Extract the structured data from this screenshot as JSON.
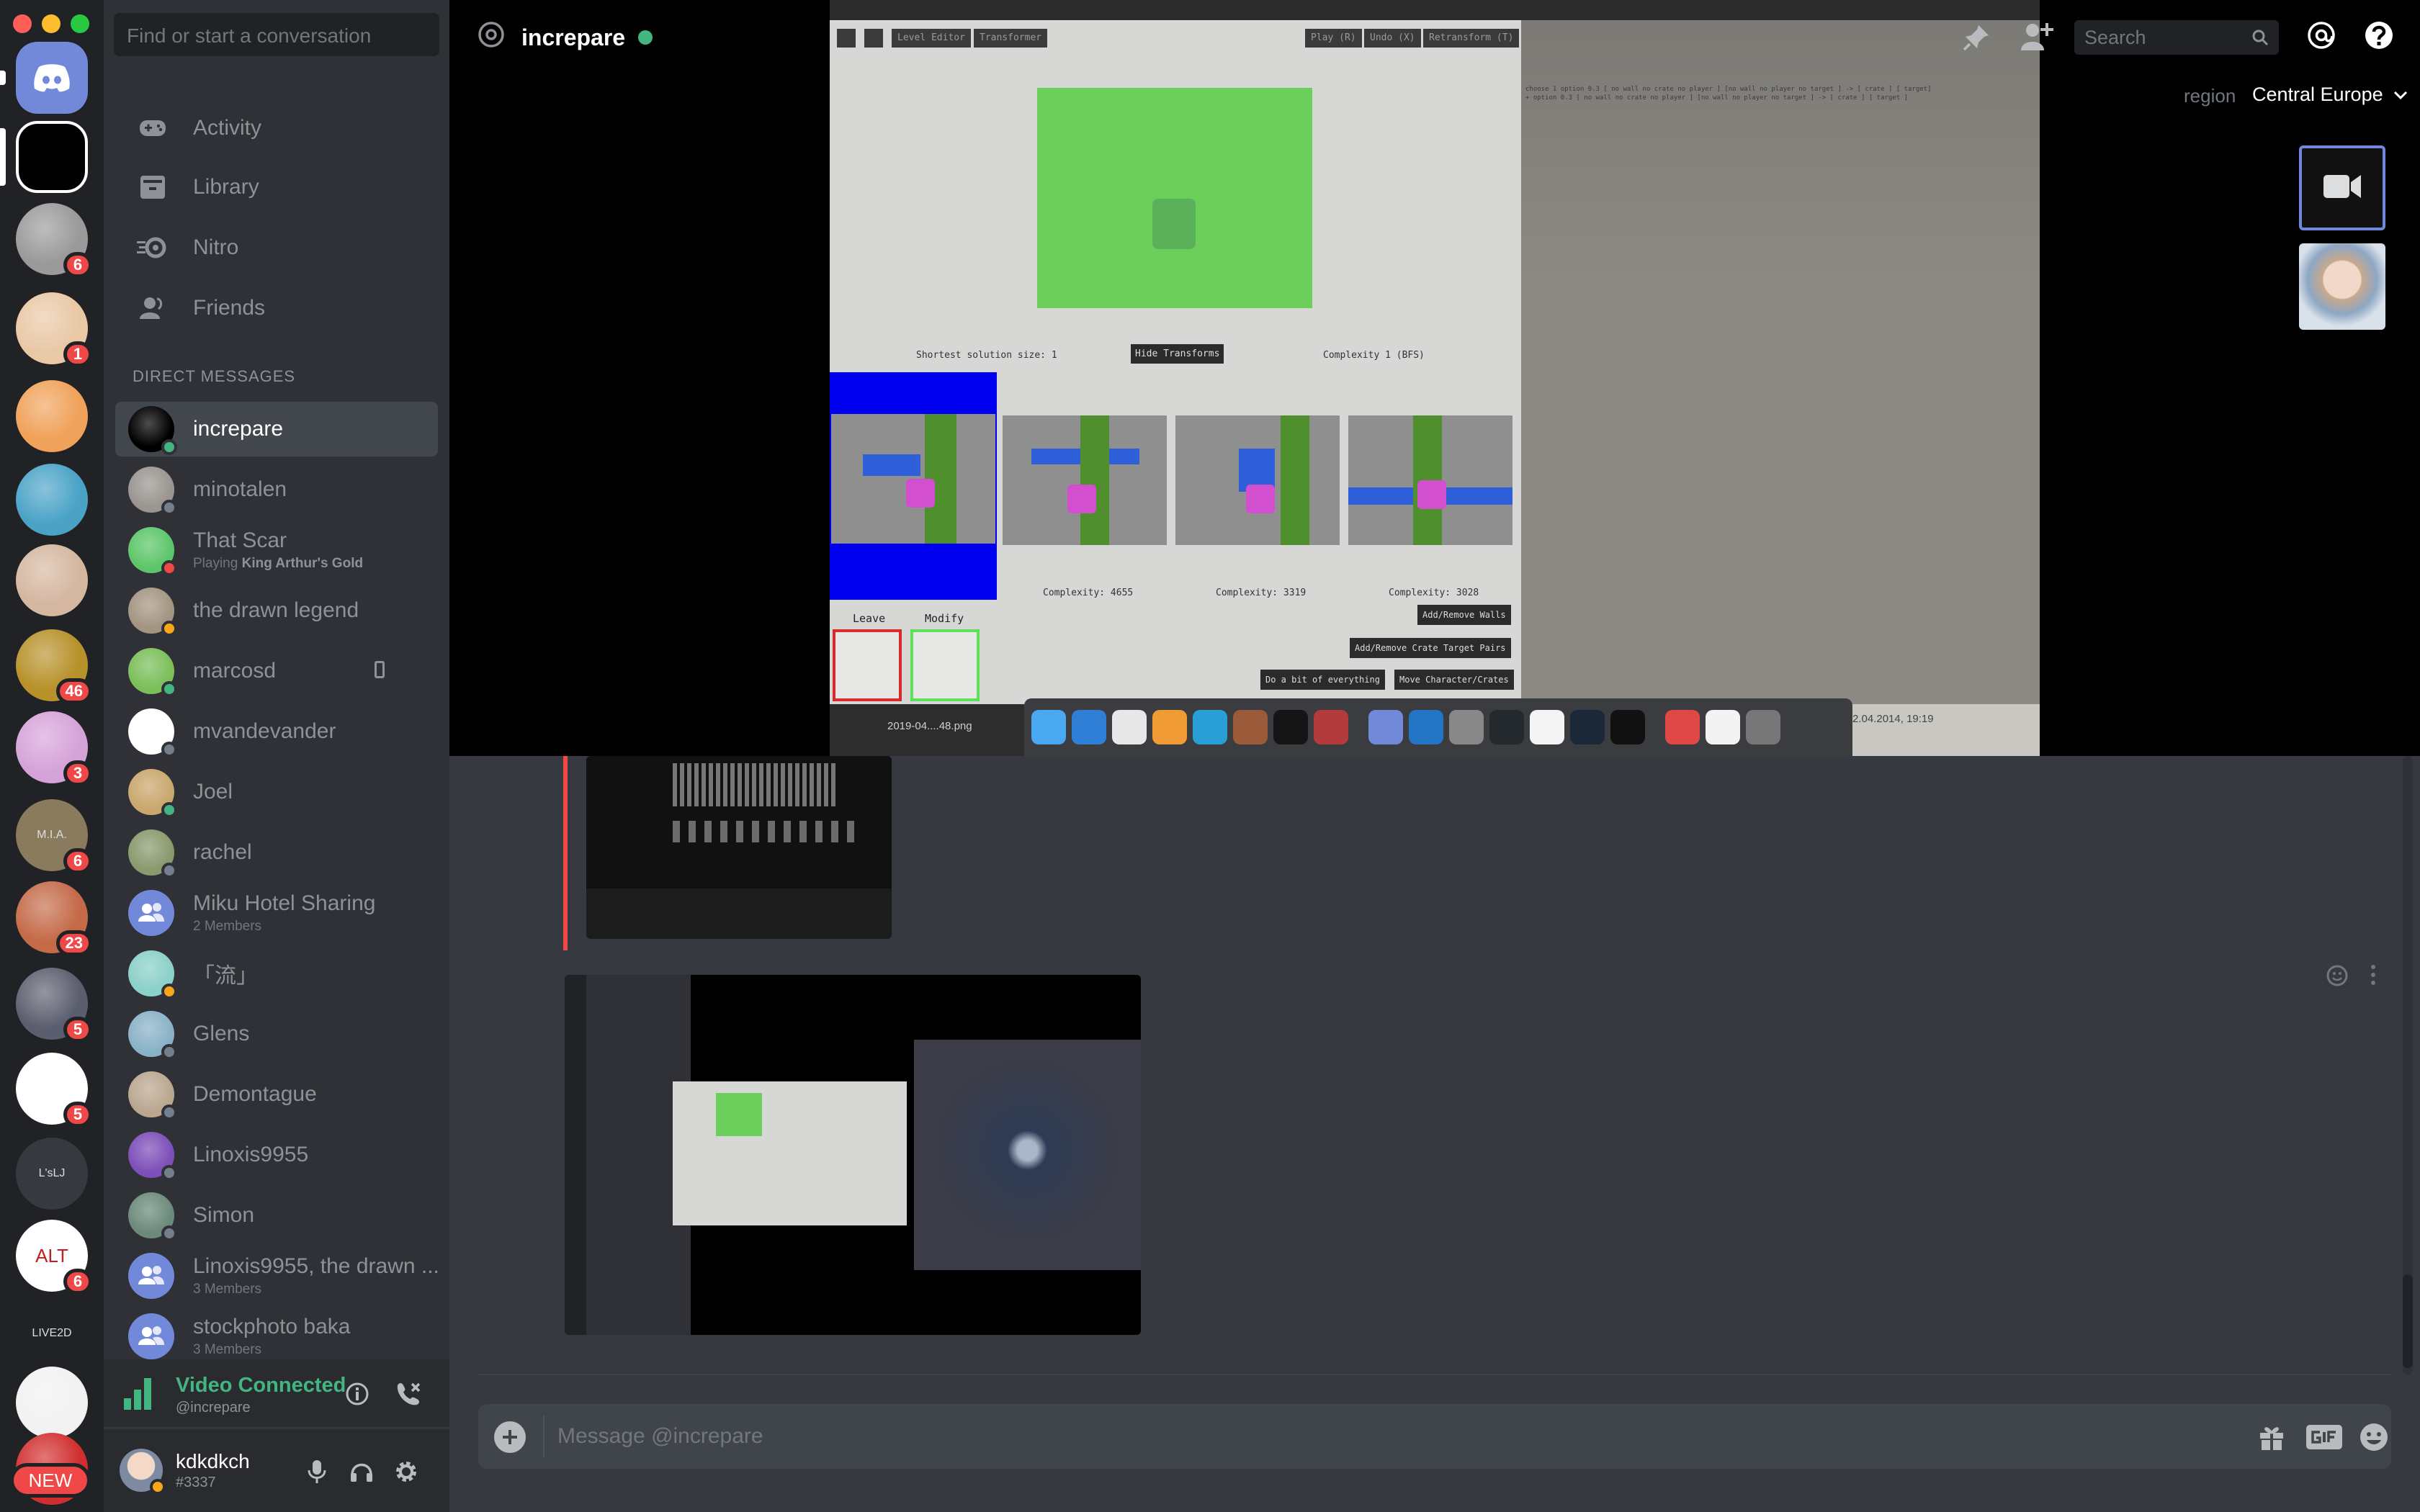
{
  "window": {
    "traffic_lights": {
      "close": "#ff5f57",
      "minimize": "#febc2e",
      "zoom": "#28c840"
    }
  },
  "servers": [
    {
      "name": "home",
      "icon": "discord-logo-icon",
      "badge": "",
      "color": "#7289da"
    },
    {
      "name": "video-call",
      "icon": "video-call-server-icon",
      "badge": "",
      "color": "#000000"
    },
    {
      "name": "server-3",
      "icon": "sketch-avatar-icon",
      "badge": "6",
      "color": "#9a9a9a"
    },
    {
      "name": "server-4",
      "icon": "anime-avatar-icon",
      "badge": "1",
      "color": "#e9c8a6"
    },
    {
      "name": "server-5",
      "icon": "skull-avatar-icon",
      "badge": "",
      "color": "#f0a25a"
    },
    {
      "name": "server-6",
      "icon": "miku-avatar-icon",
      "badge": "",
      "color": "#4aa3c7"
    },
    {
      "name": "server-7",
      "icon": "pixel-avatar-icon",
      "badge": "",
      "color": "#d5b7a0"
    },
    {
      "name": "server-8",
      "icon": "gold-avatar-icon",
      "badge": "46",
      "color": "#b7912a"
    },
    {
      "name": "server-9",
      "icon": "pink-avatar-icon",
      "badge": "3",
      "color": "#d6a3d9"
    },
    {
      "name": "server-10",
      "icon": "mia-avatar-icon",
      "badge": "6",
      "color": "#8b7b5e",
      "text": "M.I.A."
    },
    {
      "name": "server-11",
      "icon": "character-avatar-icon",
      "badge": "23",
      "color": "#c46a48"
    },
    {
      "name": "server-12",
      "icon": "robot-avatar-icon",
      "badge": "5",
      "color": "#5b5e6e"
    },
    {
      "name": "server-13",
      "icon": "graph-avatar-icon",
      "badge": "5",
      "color": "#ffffff"
    },
    {
      "name": "server-14",
      "icon": "text-server-icon",
      "badge": "",
      "color": "#36393f",
      "text": "L'sLJ"
    },
    {
      "name": "server-15",
      "icon": "alt-avatar-icon",
      "badge": "6",
      "color": "#ffffff",
      "text": "ALT"
    },
    {
      "name": "server-16",
      "icon": "live2d-avatar-icon",
      "badge": "",
      "color": "#202225",
      "text": "LIVE2D"
    },
    {
      "name": "server-17",
      "icon": "torii-avatar-icon",
      "badge": "",
      "color": "#f2f2f2"
    },
    {
      "name": "server-18",
      "icon": "red-avatar-icon",
      "badge": "",
      "color": "#d12f2f"
    }
  ],
  "new_badge": "NEW",
  "sidebar": {
    "search_placeholder": "Find or start a conversation",
    "nav": [
      {
        "label": "Activity",
        "icon": "gamepad-icon"
      },
      {
        "label": "Library",
        "icon": "library-icon"
      },
      {
        "label": "Nitro",
        "icon": "nitro-icon"
      },
      {
        "label": "Friends",
        "icon": "friends-icon"
      }
    ],
    "dm_header": "DIRECT MESSAGES",
    "dms": [
      {
        "name": "increpare",
        "sub": "",
        "status": "online",
        "avatar": "#000000",
        "active": true
      },
      {
        "name": "minotalen",
        "sub": "",
        "status": "offline",
        "avatar": "#9a9590"
      },
      {
        "name": "That Scar",
        "sub_prefix": "Playing ",
        "sub_game": "King Arthur's Gold",
        "status": "dnd",
        "avatar": "#5ec66a"
      },
      {
        "name": "the drawn legend",
        "sub": "",
        "status": "idle",
        "avatar": "#a49582"
      },
      {
        "name": "marcosd",
        "sub": "",
        "status": "online",
        "avatar": "#7bbf5a",
        "mobile": true
      },
      {
        "name": "mvandevander",
        "sub": "",
        "status": "offline",
        "avatar": "#ffffff"
      },
      {
        "name": "Joel",
        "sub": "",
        "status": "online",
        "avatar": "#caa76e"
      },
      {
        "name": "rachel",
        "sub": "",
        "status": "offline",
        "avatar": "#8a9a6e"
      },
      {
        "name": "Miku Hotel Sharing",
        "sub": "2 Members",
        "status": "",
        "avatar": "#7289da",
        "group": true
      },
      {
        "name": "「流」",
        "sub": "",
        "status": "idle",
        "avatar": "#8bd0c9"
      },
      {
        "name": "Glens",
        "sub": "",
        "status": "offline",
        "avatar": "#8ab2c7"
      },
      {
        "name": "Demontague",
        "sub": "",
        "status": "offline",
        "avatar": "#bba790"
      },
      {
        "name": "Linoxis9955",
        "sub": "",
        "status": "offline",
        "avatar": "#7d4fb8"
      },
      {
        "name": "Simon",
        "sub": "",
        "status": "offline",
        "avatar": "#6c8a7a"
      },
      {
        "name": "Linoxis9955, the drawn ...",
        "sub": "3 Members",
        "status": "",
        "avatar": "#7289da",
        "group": true
      },
      {
        "name": "stockphoto baka",
        "sub": "3 Members",
        "status": "",
        "avatar": "#7289da",
        "group": true
      }
    ],
    "voice": {
      "status": "Video Connected",
      "channel": "@increpare"
    },
    "user": {
      "name": "kdkdkch",
      "tag": "#3337"
    }
  },
  "header": {
    "title": "increpare",
    "search_placeholder": "Search",
    "region_label": "region",
    "region_value": "Central Europe"
  },
  "stream": {
    "toolbar": [
      "Level Editor",
      "Transformer"
    ],
    "toolbar_right": [
      "Play (R)",
      "Undo (X)",
      "Retransform (T)"
    ],
    "shortest": "Shortest solution size: 1",
    "hide_button": "Hide Transforms",
    "complexity_main": "Complexity 1 (BFS)",
    "complexities": [
      "Complexity: 4655",
      "Complexity: 3319",
      "Complexity: 3028"
    ],
    "leave": "Leave",
    "modify": "Modify",
    "actions": [
      "Add/Remove Walls",
      "Add/Remove Crate Target Pairs",
      "Do a bit of everything",
      "Move Character/Crates"
    ],
    "desktop_file": "2019-04....48.png",
    "desktop_date": "2.04.2014, 19:19"
  },
  "composer": {
    "placeholder": "Message @increpare"
  }
}
